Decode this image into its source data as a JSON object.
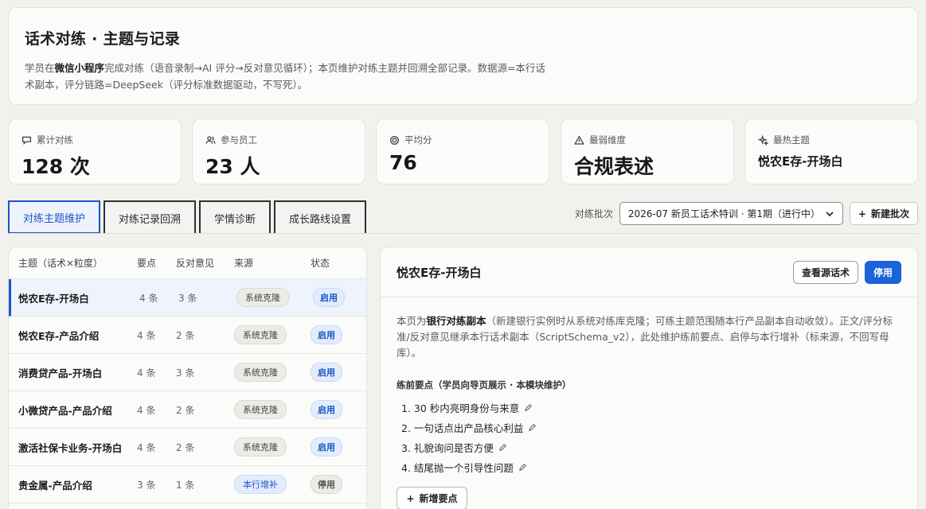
{
  "header": {
    "title": "话术对练 · 主题与记录",
    "desc_1": "学员在",
    "desc_bold": "微信小程序",
    "desc_2": "完成对练（语音录制→AI 评分→反对意见循环）；本页维护对练主题并回溯全部记录。数据源=本行话术副本，评分链路=DeepSeek（评分标准数据驱动，不写死）。"
  },
  "stats": [
    {
      "icon": "chat-icon",
      "label": "累计对练",
      "value": "128 次"
    },
    {
      "icon": "users-icon",
      "label": "参与员工",
      "value": "23 人"
    },
    {
      "icon": "target-icon",
      "label": "平均分",
      "value": "76"
    },
    {
      "icon": "warning-icon",
      "label": "最弱维度",
      "value": "合规表述"
    },
    {
      "icon": "sparkle-icon",
      "label": "最热主题",
      "value": "悦农E存-开场白"
    }
  ],
  "tabs": [
    "对练主题维护",
    "对练记录回溯",
    "学情诊断",
    "成长路线设置"
  ],
  "batch": {
    "label": "对练批次",
    "selected": "2026-07 新员工话术特训 · 第1期（进行中）",
    "new_button": "新建批次"
  },
  "table": {
    "columns": [
      "主题（话术×粒度）",
      "要点",
      "反对意见",
      "来源",
      "状态"
    ],
    "rows": [
      {
        "topic": "悦农E存-开场白",
        "points": "4 条",
        "objections": "3 条",
        "source": "系统克隆",
        "status": "启用"
      },
      {
        "topic": "悦农E存-产品介绍",
        "points": "4 条",
        "objections": "2 条",
        "source": "系统克隆",
        "status": "启用"
      },
      {
        "topic": "消费贷产品-开场白",
        "points": "4 条",
        "objections": "3 条",
        "source": "系统克隆",
        "status": "启用"
      },
      {
        "topic": "小微贷产品-产品介绍",
        "points": "4 条",
        "objections": "2 条",
        "source": "系统克隆",
        "status": "启用"
      },
      {
        "topic": "激活社保卡业务-开场白",
        "points": "4 条",
        "objections": "2 条",
        "source": "系统克隆",
        "status": "启用"
      },
      {
        "topic": "贵金属-产品介绍",
        "points": "3 条",
        "objections": "1 条",
        "source": "本行增补",
        "status": "停用"
      }
    ]
  },
  "detail": {
    "title": "悦农E存-开场白",
    "view_source_button": "查看源话术",
    "disable_button": "停用",
    "text_1": "本页为",
    "text_bold": "银行对练副本",
    "text_2": "（新建银行实例时从系统对练库克隆；可练主题范围随本行产品副本自动收敛）。正文/评分标准/反对意见继承本行话术副本（ScriptSchema_v2），此处维护练前要点、启停与本行增补（标来源，不回写母库）。",
    "section_title": "练前要点（学员向导页展示 · 本模块维护）",
    "points": [
      "1. 30 秒内亮明身份与来意",
      "2. 一句话点出产品核心利益",
      "3. 礼貌询问是否方便",
      "4. 结尾抛一个引导性问题"
    ],
    "add_button": "新增要点"
  },
  "colors": {
    "accent": "#1a56c9",
    "primary_button": "#1a63d8",
    "background": "#f1f1ee"
  }
}
